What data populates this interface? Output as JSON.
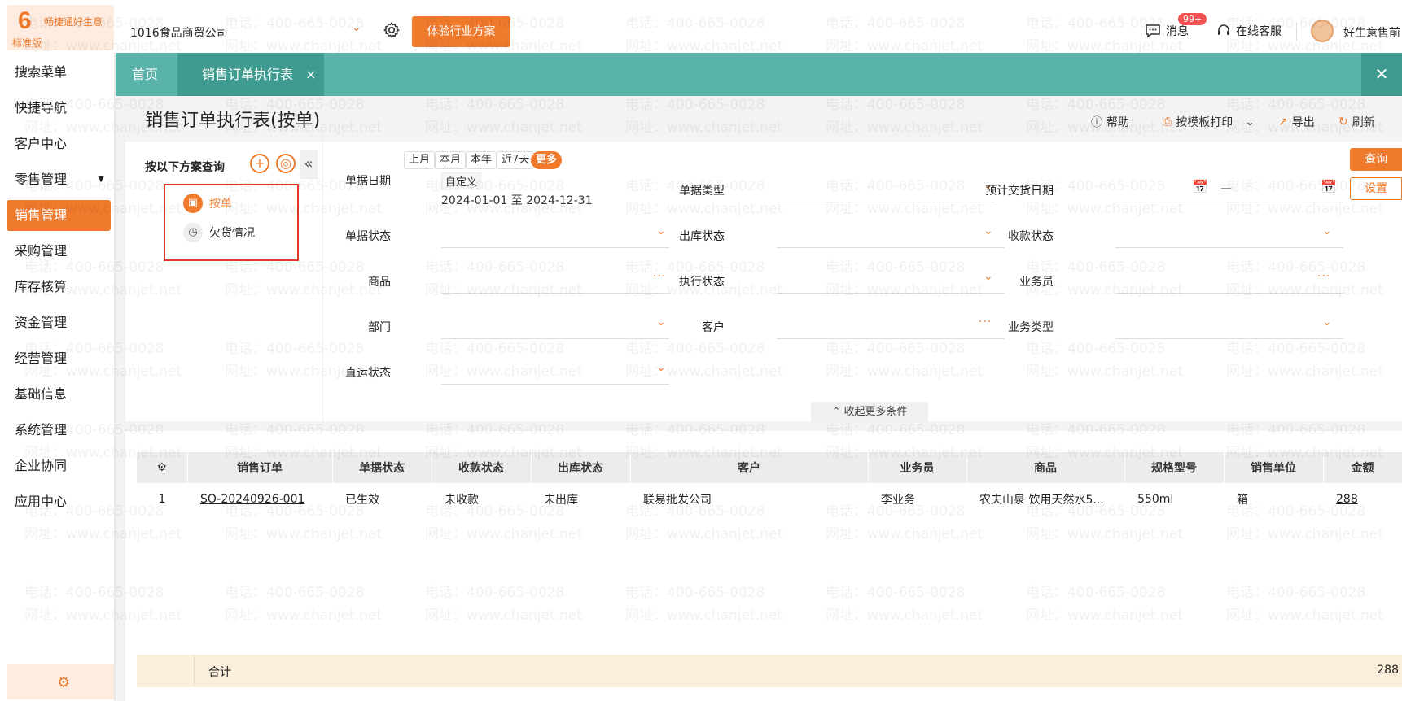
{
  "topbar": {
    "brand": "畅捷通好生意",
    "edition": "标准版",
    "company": "1016食品商贸公司",
    "trial_button": "体验行业方案",
    "messages_label": "消息",
    "messages_badge": "99+",
    "service_label": "在线客服",
    "username": "好生意售前"
  },
  "sidebar": {
    "items": [
      {
        "label": "搜索菜单"
      },
      {
        "label": "快捷导航"
      },
      {
        "label": "客户中心"
      },
      {
        "label": "零售管理"
      },
      {
        "label": "销售管理"
      },
      {
        "label": "采购管理"
      },
      {
        "label": "库存核算"
      },
      {
        "label": "资金管理"
      },
      {
        "label": "经营管理"
      },
      {
        "label": "基础信息"
      },
      {
        "label": "系统管理"
      },
      {
        "label": "企业协同"
      },
      {
        "label": "应用中心"
      }
    ],
    "active_index": 4
  },
  "tabs": {
    "home": "首页",
    "active": "销售订单执行表",
    "close_glyph": "×"
  },
  "page": {
    "title": "销售订单执行表(按单)",
    "actions": {
      "help": "帮助",
      "print": "按模板打印",
      "export": "导出",
      "refresh": "刷新"
    }
  },
  "scheme": {
    "label": "按以下方案查询",
    "items": [
      "按单",
      "欠货情况"
    ],
    "selected": "按单"
  },
  "filters": {
    "doc_date": {
      "label": "单据日期",
      "quick": [
        "上月",
        "本月",
        "本年",
        "近7天",
        "更多"
      ],
      "custom": "自定义",
      "range": "2024-01-01 至 2024-12-31"
    },
    "doc_type": {
      "label": "单据类型"
    },
    "delivery_date": {
      "label": "预计交货日期",
      "separator": "—"
    },
    "doc_status": {
      "label": "单据状态"
    },
    "outbound_status": {
      "label": "出库状态"
    },
    "payment_status": {
      "label": "收款状态"
    },
    "product": {
      "label": "商品"
    },
    "exec_status": {
      "label": "执行状态"
    },
    "salesperson": {
      "label": "业务员"
    },
    "department": {
      "label": "部门"
    },
    "customer": {
      "label": "客户"
    },
    "business_type": {
      "label": "业务类型"
    },
    "direct_status": {
      "label": "直运状态"
    },
    "collapse_more": "收起更多条件",
    "query_button": "查询",
    "settings_button": "设置"
  },
  "table": {
    "columns": [
      "销售订单",
      "单据状态",
      "收款状态",
      "出库状态",
      "客户",
      "业务员",
      "商品",
      "规格型号",
      "销售单位",
      "金额"
    ],
    "rows": [
      {
        "no": "1",
        "order": "SO-20240926-001",
        "doc_status": "已生效",
        "payment_status": "未收款",
        "outbound_status": "未出库",
        "customer": "联易批发公司",
        "salesperson": "李业务",
        "product": "农夫山泉 饮用天然水5...",
        "spec": "550ml",
        "unit": "箱",
        "amount": "288"
      }
    ],
    "total_label": "合计",
    "total_amount": "288"
  },
  "watermark": {
    "phone": "电话：400-665-0028",
    "site": "网址：www.chanjet.net"
  },
  "colors": {
    "accent": "#f07a2c",
    "teal": "#5ab3a9",
    "teal_dark": "#3f9b8f"
  }
}
